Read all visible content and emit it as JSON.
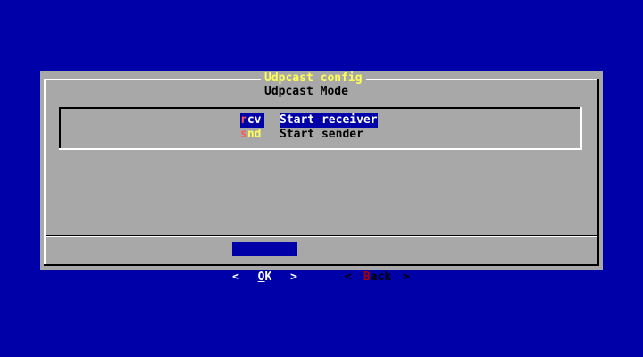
{
  "dialog": {
    "title": "Udpcast config",
    "subtitle": "Udpcast Mode"
  },
  "menu": {
    "items": [
      {
        "tag_hot": "r",
        "tag_rest": "cv",
        "label": "Start receiver",
        "selected": true
      },
      {
        "tag_hot": "s",
        "tag_rest": "nd",
        "label": "Start sender",
        "selected": false
      }
    ]
  },
  "buttons": {
    "ok": {
      "left": "<",
      "hot": "O",
      "rest": "K",
      "right": ">",
      "focused": true
    },
    "back": {
      "left": "<",
      "hot": "B",
      "rest": "ack",
      "right": ">",
      "focused": false
    }
  },
  "colors": {
    "background": "#0000a8",
    "dialog": "#a8a8a8",
    "title": "#ffff54",
    "hotkey": "#ff5454",
    "highlight": "#0000a8"
  }
}
